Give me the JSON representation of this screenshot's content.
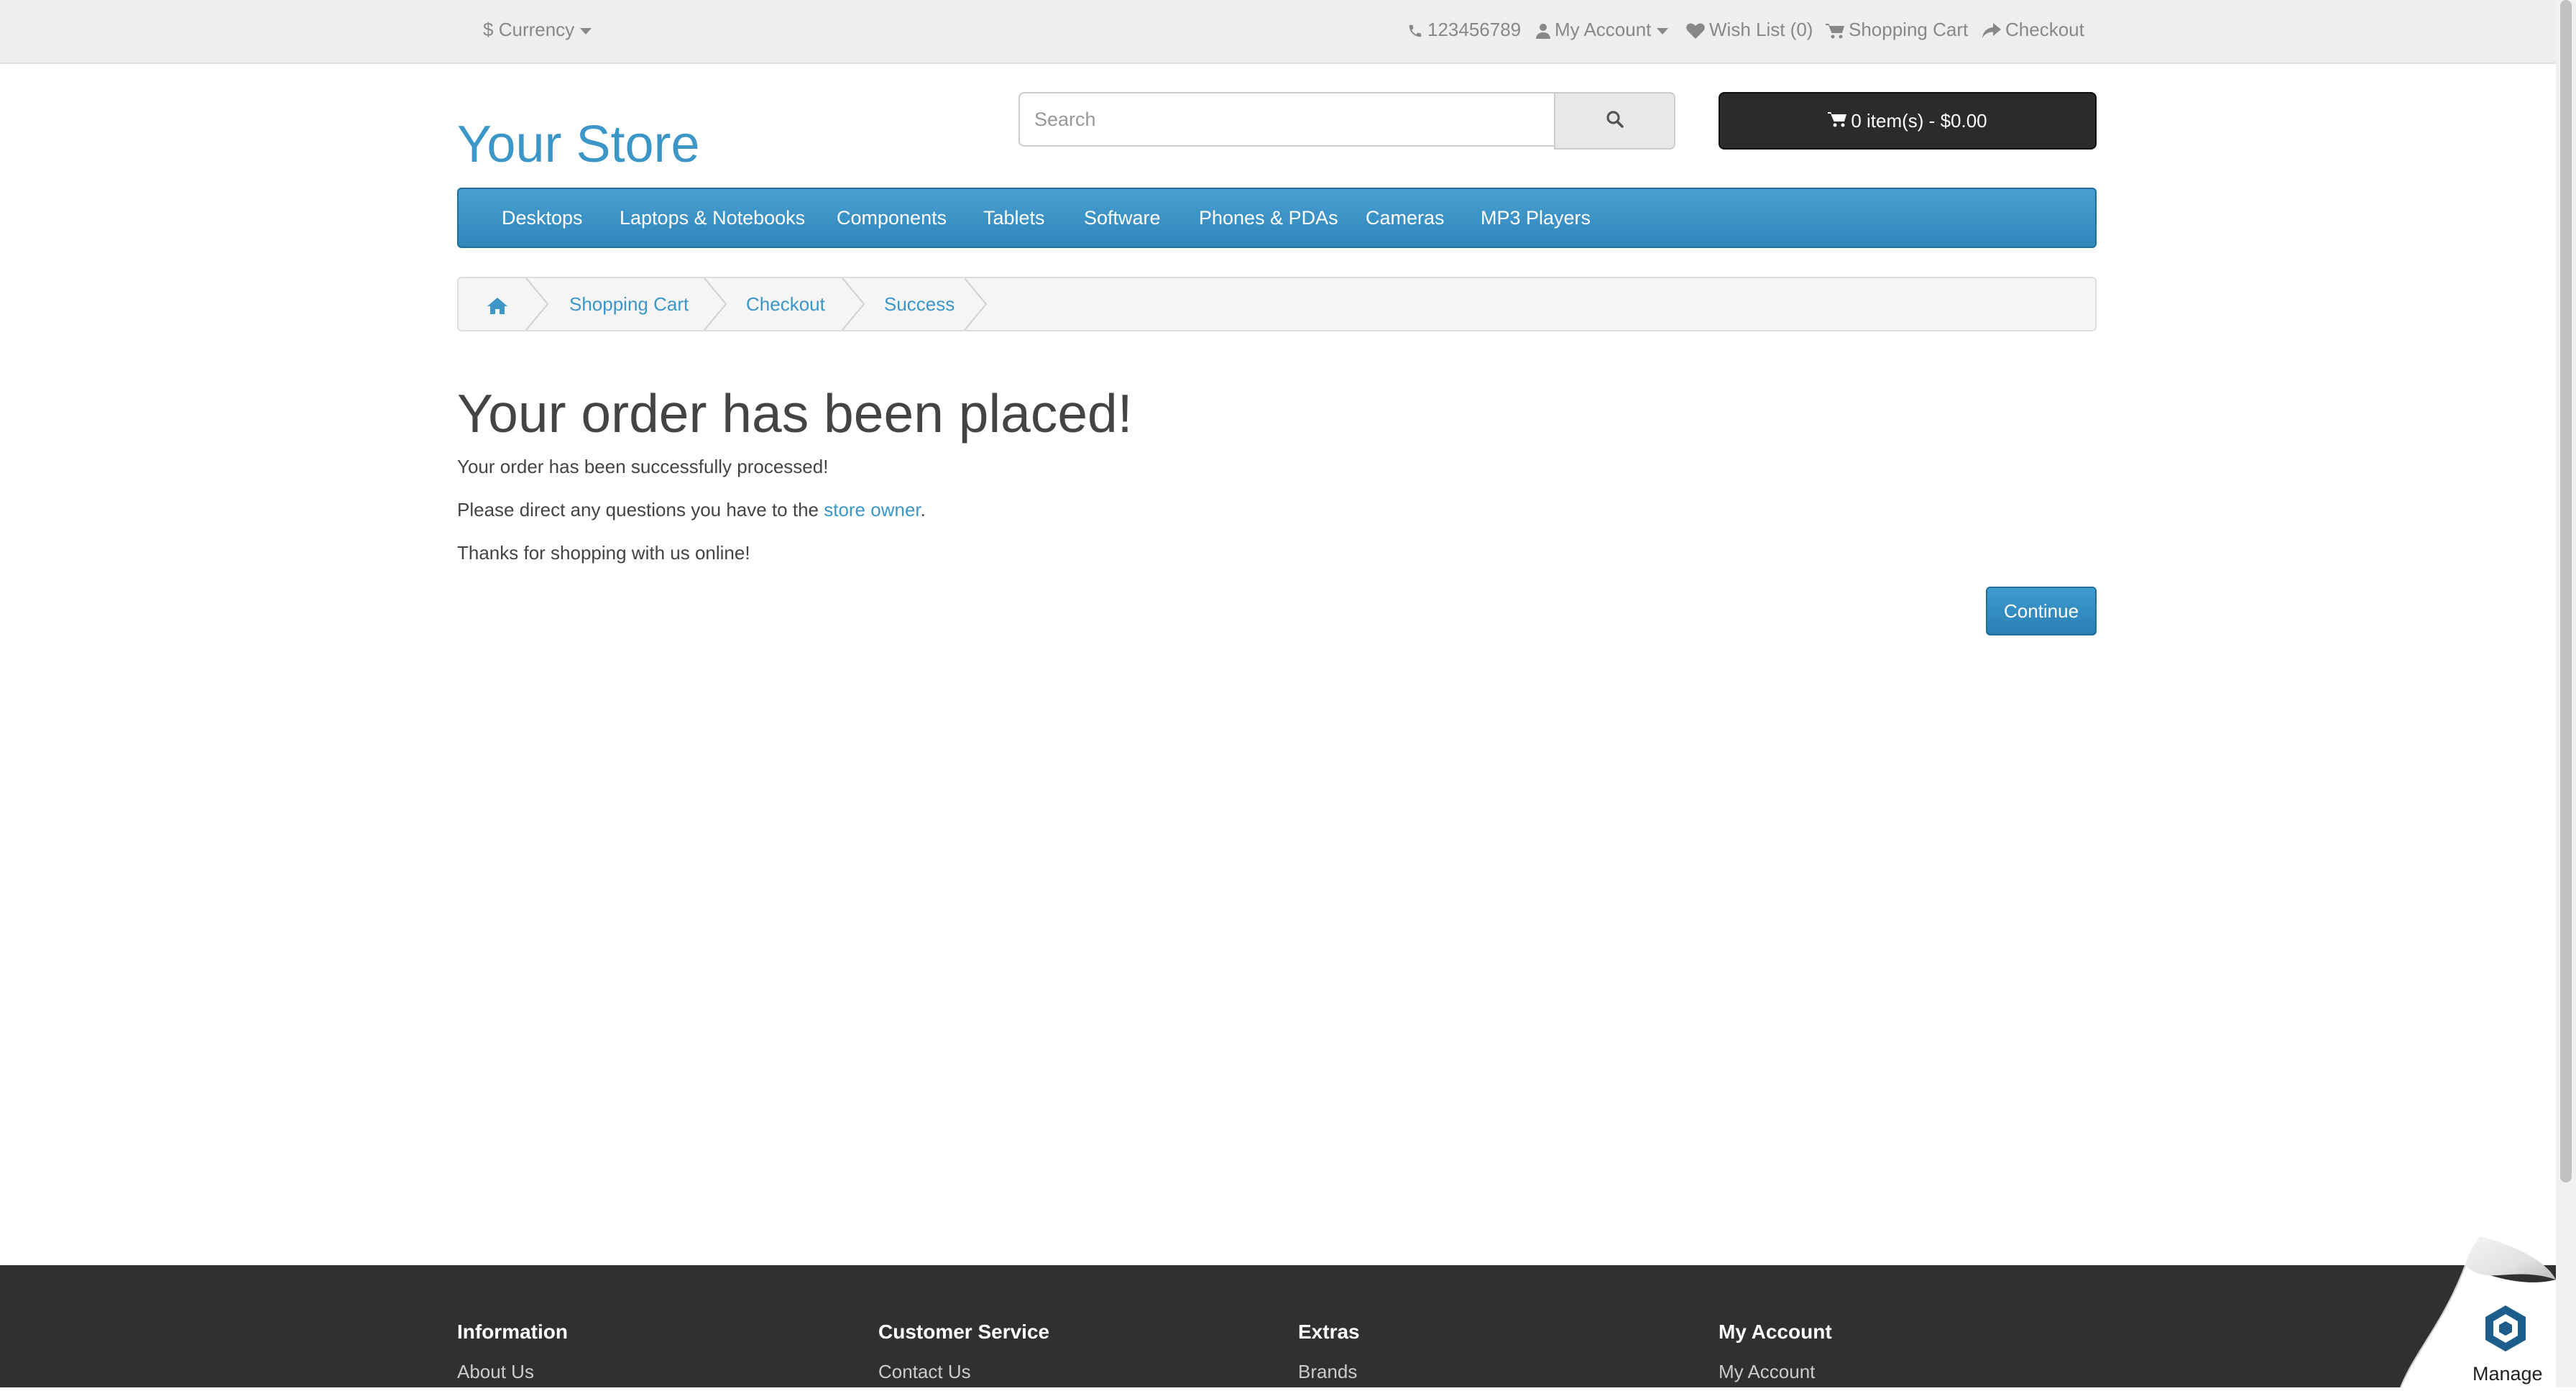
{
  "topbar": {
    "currency": {
      "symbol": "$",
      "label": "Currency"
    },
    "phone": "123456789",
    "my_account": "My Account",
    "wish_list": "Wish List (0)",
    "shopping_cart": "Shopping Cart",
    "checkout": "Checkout"
  },
  "header": {
    "logo": "Your Store",
    "search": {
      "placeholder": "Search",
      "value": ""
    },
    "cart_button": "0 item(s) - $0.00"
  },
  "menu": {
    "items": [
      {
        "label": "Desktops"
      },
      {
        "label": "Laptops & Notebooks"
      },
      {
        "label": "Components"
      },
      {
        "label": "Tablets"
      },
      {
        "label": "Software"
      },
      {
        "label": "Phones & PDAs"
      },
      {
        "label": "Cameras"
      },
      {
        "label": "MP3 Players"
      }
    ]
  },
  "breadcrumb": {
    "items": [
      {
        "label": "Shopping Cart"
      },
      {
        "label": "Checkout"
      },
      {
        "label": "Success"
      }
    ]
  },
  "content": {
    "title": "Your order has been placed!",
    "line1": "Your order has been successfully processed!",
    "line2_prefix": "Please direct any questions you have to the ",
    "line2_link": "store owner",
    "line2_suffix": ".",
    "line3": "Thanks for shopping with us online!",
    "continue_label": "Continue"
  },
  "footer": {
    "columns": [
      {
        "heading": "Information",
        "first_link": "About Us"
      },
      {
        "heading": "Customer Service",
        "first_link": "Contact Us"
      },
      {
        "heading": "Extras",
        "first_link": "Brands"
      },
      {
        "heading": "My Account",
        "first_link": "My Account"
      }
    ]
  },
  "widget": {
    "label": "Manage"
  },
  "colors": {
    "accent": "#3c96c8",
    "menu_bg": "#3a8fc4",
    "cart_bg": "#2b2b2b",
    "footer_bg": "#303030"
  },
  "icons": {
    "phone": "phone-icon",
    "user": "user-icon",
    "heart": "heart-icon",
    "cart": "cart-icon",
    "share": "share-icon",
    "search": "search-icon",
    "home": "home-icon"
  }
}
